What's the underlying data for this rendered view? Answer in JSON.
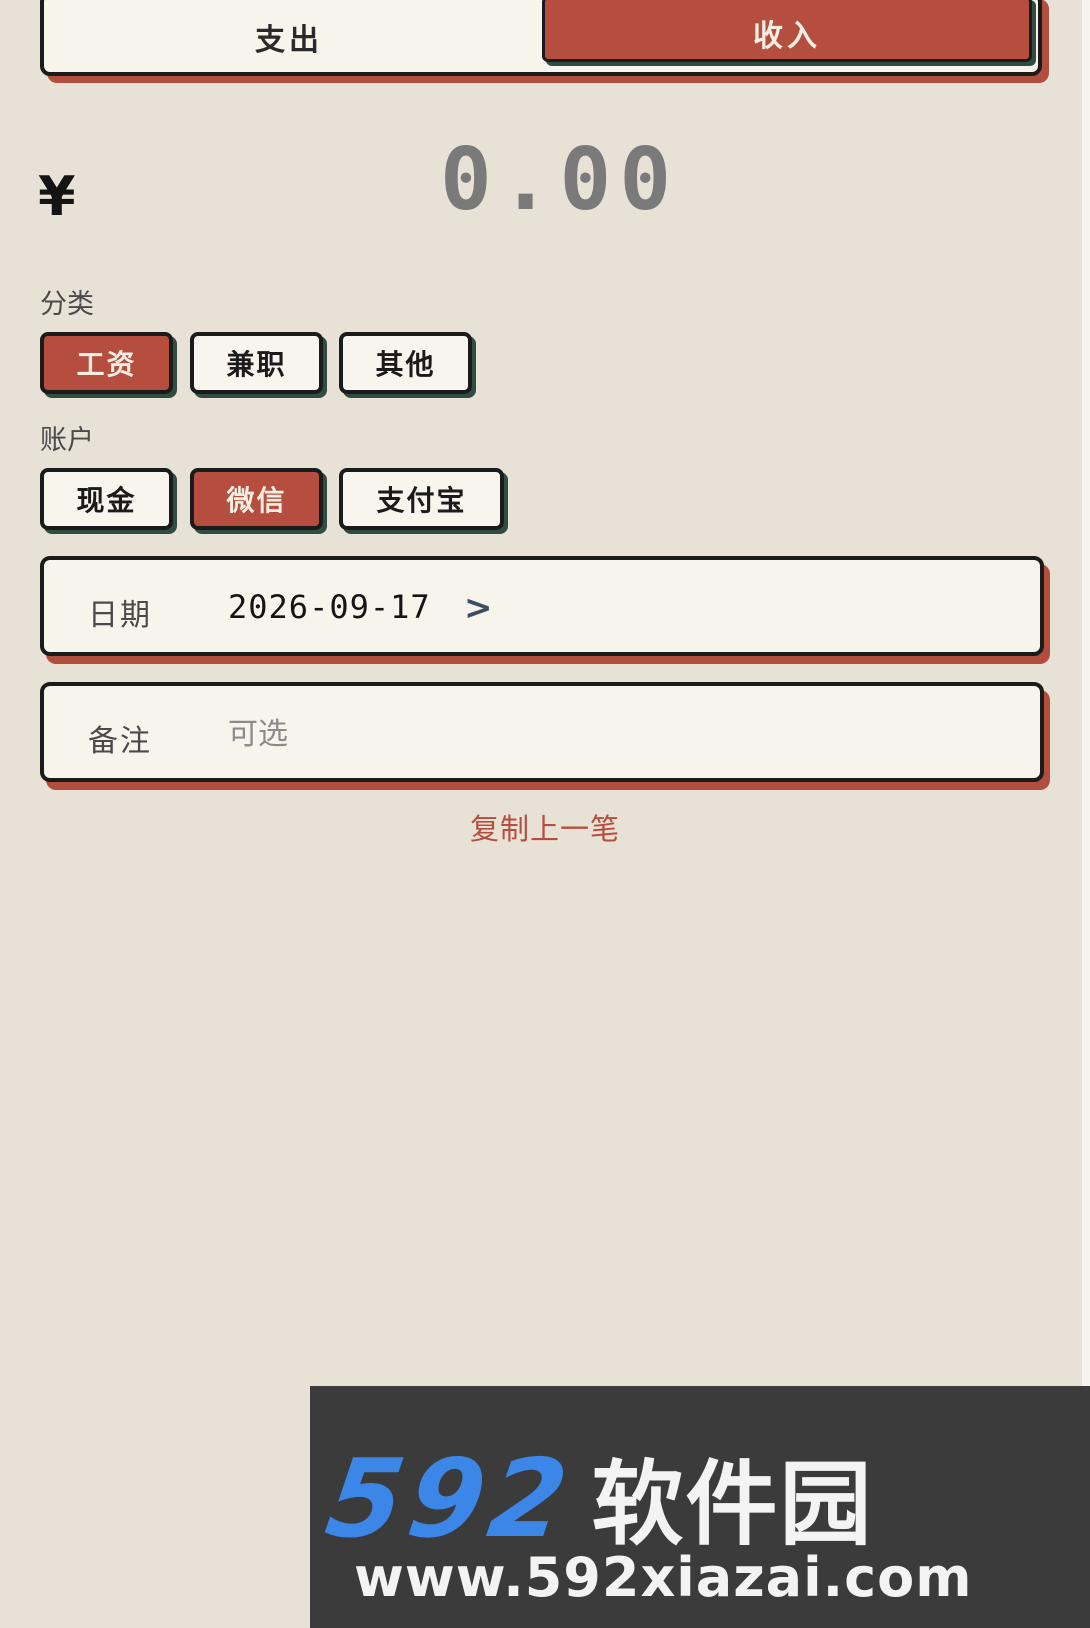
{
  "type_toggle": {
    "expense_label": "支出",
    "income_label": "收入",
    "selected": "收入"
  },
  "amount": {
    "currency": "¥",
    "value": "0.00"
  },
  "category": {
    "label": "分类",
    "options": [
      "工资",
      "兼职",
      "其他"
    ],
    "selected": "工资"
  },
  "account": {
    "label": "账户",
    "options": [
      "现金",
      "微信",
      "支付宝"
    ],
    "selected": "微信"
  },
  "date_field": {
    "label": "日期",
    "value": "2026-09-17",
    "chevron": ">"
  },
  "note_field": {
    "label": "备注",
    "placeholder": "可选"
  },
  "copy_last": {
    "label": "复制上一笔"
  },
  "watermark": {
    "logo_number": "592",
    "logo_text": "软件园",
    "url": "www.592xiazai.com"
  },
  "colors": {
    "background": "#e8e2d6",
    "card": "#f7f4ec",
    "accent": "#b54e3e",
    "border": "#1b1b1b",
    "chip_shadow": "#2f4d40",
    "muted_amount": "#7a7a7a"
  }
}
